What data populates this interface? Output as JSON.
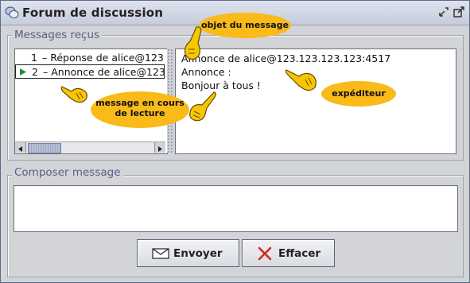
{
  "window": {
    "title": "Forum de discussion"
  },
  "received": {
    "legend": "Messages reçus",
    "items": [
      {
        "num": "1",
        "text": "– Réponse de alice@123."
      },
      {
        "num": "2",
        "text": "– Annonce de alice@123."
      }
    ]
  },
  "message": {
    "lines": [
      "Annonce de alice@123.123.123.123:4517",
      "Annonce :",
      "Bonjour à tous !"
    ]
  },
  "compose": {
    "legend": "Composer message"
  },
  "buttons": {
    "send_label": "Envoyer",
    "clear_label": "Effacer"
  },
  "annotations": {
    "subject": "objet du message",
    "sender": "expéditeur",
    "current_line1": "message en cours",
    "current_line2": "de lecture"
  },
  "colors": {
    "accent": "#5a5f84",
    "bubble": "#f9ba1a",
    "clear_icon": "#d4271b",
    "selection_arrow": "#2e8b2e"
  }
}
